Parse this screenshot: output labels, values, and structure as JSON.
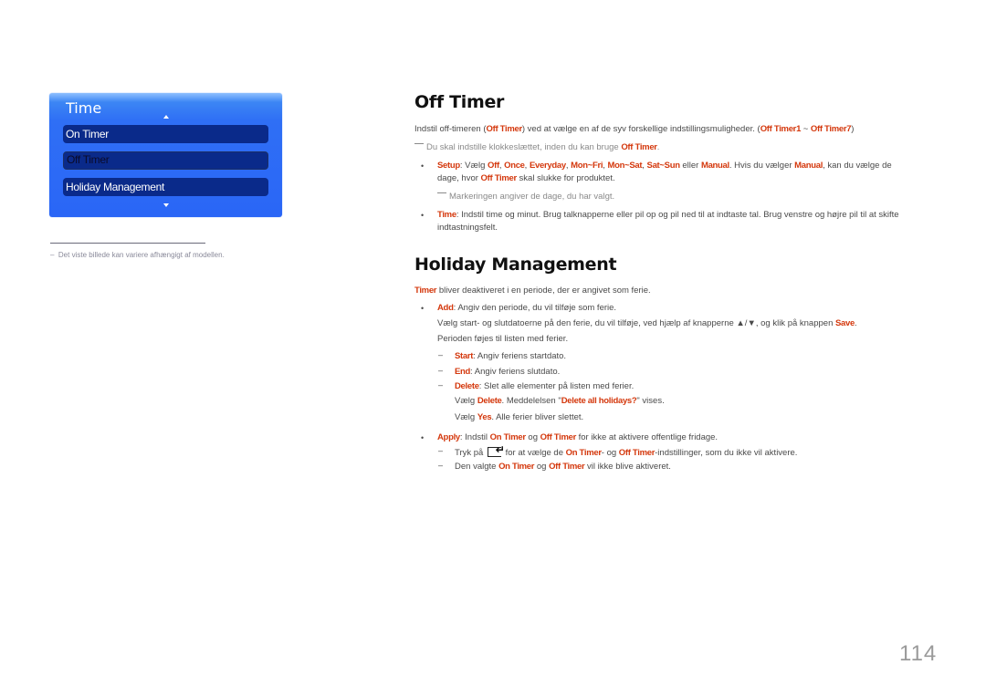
{
  "menu": {
    "title": "Time",
    "items": [
      {
        "label": "On Timer",
        "selected": false
      },
      {
        "label": "Off Timer",
        "selected": true
      },
      {
        "label": "Holiday Management",
        "selected": false
      }
    ],
    "footnote": "Det viste billede kan variere afhængigt af modellen."
  },
  "off_timer": {
    "heading": "Off Timer",
    "intro": {
      "a": "Indstil off-timeren (",
      "b": "Off Timer",
      "c": ") ved at vælge en af de syv forskellige indstillingsmuligheder. (",
      "d": "Off Timer1",
      "e": " ~ ",
      "f": "Off Timer7",
      "g": ")"
    },
    "note1": {
      "a": "Du skal indstille klokkeslættet, inden du kan bruge ",
      "b": "Off Timer",
      "c": "."
    },
    "setup": {
      "label": "Setup",
      "t1": ": Vælg ",
      "o1": "Off",
      "s1": ", ",
      "o2": "Once",
      "s2": ", ",
      "o3": "Everyday",
      "s3": ", ",
      "o4": "Mon~Fri",
      "s4": ", ",
      "o5": "Mon~Sat",
      "s5": ", ",
      "o6": "Sat~Sun",
      "t2": " eller ",
      "o7": "Manual",
      "t3": ". Hvis du vælger ",
      "o8": "Manual",
      "t4": ", kan du vælge de",
      "line2a": "dage, hvor ",
      "line2b": "Off Timer",
      "line2c": " skal slukke for produktet.",
      "note": "Markeringen angiver de dage, du har valgt."
    },
    "time": {
      "label": "Time",
      "line1": ": Indstil time og minut. Brug talknapperne eller pil op og pil ned til at indtaste tal. Brug venstre og højre pil til at skifte",
      "line2": "indtastningsfelt."
    }
  },
  "holiday": {
    "heading": "Holiday Management",
    "intro": {
      "a": "Timer",
      "b": " bliver deaktiveret i en periode, der er angivet som ferie."
    },
    "add": {
      "label": "Add",
      "line1": ": Angiv den periode, du vil tilføje som ferie.",
      "line2a": "Vælg start- og slutdatoerne på den ferie, du vil tilføje, ved hjælp af knapperne ▲/▼, og klik på knappen ",
      "line2b": "Save",
      "line2c": ".",
      "line3": "Perioden føjes til listen med ferier.",
      "start": {
        "label": "Start",
        "text": ": Angiv feriens startdato."
      },
      "end": {
        "label": "End",
        "text": ": Angiv feriens slutdato."
      },
      "delete": {
        "label": "Delete",
        "text": ": Slet alle elementer på listen med ferier.",
        "l2a": "Vælg ",
        "l2b": "Delete",
        "l2c": ". Meddelelsen \"",
        "l2d": "Delete all holidays?",
        "l2e": "\" vises.",
        "l3a": "Vælg ",
        "l3b": "Yes",
        "l3c": ". Alle ferier bliver slettet."
      }
    },
    "apply": {
      "label": "Apply",
      "t1": ": Indstil ",
      "h1": "On Timer",
      "t2": " og ",
      "h2": "Off Timer",
      "t3": " for ikke at aktivere offentlige fridage.",
      "d1a": "Tryk på ",
      "d1b": " for at vælge de ",
      "d1c": "On Timer",
      "d1d": "- og ",
      "d1e": "Off Timer",
      "d1f": "-indstillinger, som du ikke vil aktivere.",
      "d2a": "Den valgte ",
      "d2b": "On Timer",
      "d2c": " og ",
      "d2d": "Off Timer",
      "d2e": " vil ikke blive aktiveret."
    }
  },
  "page_number": "114",
  "colors": {
    "highlight": "#d4380d",
    "menu_blue": "#2a66f6",
    "menu_item": "#0a2a8a"
  }
}
